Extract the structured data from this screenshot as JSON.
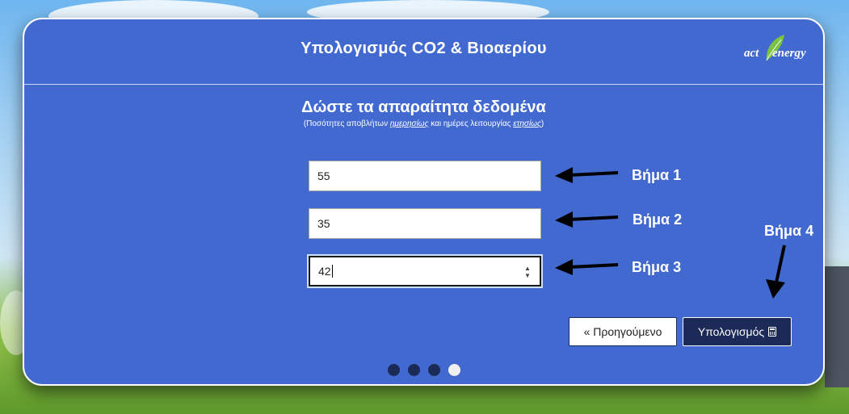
{
  "header": {
    "title": "Υπολογισμός CO2 & Βιοαερίου",
    "logo_text_left": "act",
    "logo_text_right": "energy"
  },
  "form": {
    "heading": "Δώστε τα απαραίτητα δεδομένα",
    "hint_prefix": "(Ποσότητες αποβλήτων ",
    "hint_daily": "ημερησίως",
    "hint_middle": " και ημέρες λειτουργίας ",
    "hint_yearly": "ετησίως",
    "hint_suffix": ")",
    "fields": [
      {
        "value": "55"
      },
      {
        "value": "35"
      },
      {
        "value": "42"
      }
    ]
  },
  "annotations": {
    "step1": "Βήμα 1",
    "step2": "Βήμα 2",
    "step3": "Βήμα 3",
    "step4": "Βήμα 4"
  },
  "buttons": {
    "prev_label": "« Προηγούμενο",
    "calc_label": "Υπολογισμός",
    "calc_icon": "calculator-icon"
  },
  "pagination": {
    "total": 4,
    "current": 4
  },
  "colors": {
    "panel": "#4169cf",
    "dark": "#1b2a57",
    "logo_leaf": "#7cc242"
  }
}
